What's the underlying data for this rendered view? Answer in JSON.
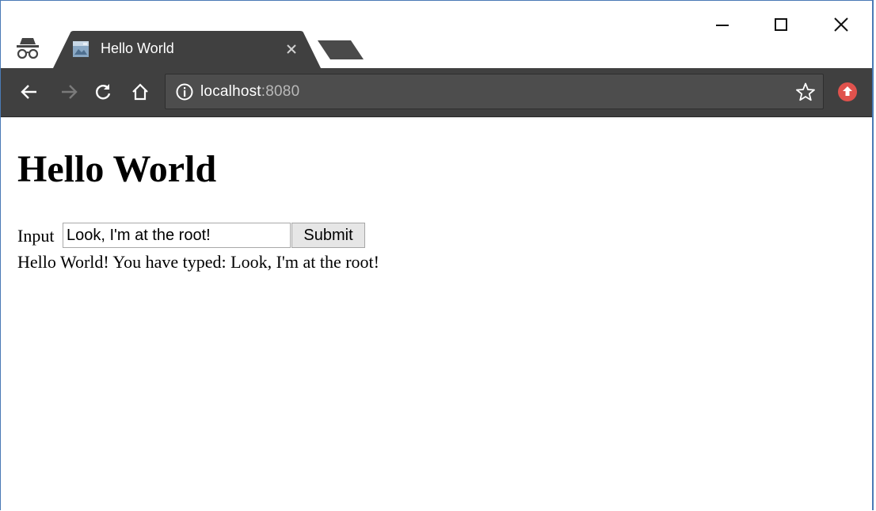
{
  "browser": {
    "mode_icon": "incognito-icon",
    "tab": {
      "title": "Hello World",
      "favicon": "page-favicon-icon",
      "close_icon": "close-icon"
    },
    "window_controls": {
      "minimize_icon": "minimize-icon",
      "maximize_icon": "maximize-icon",
      "close_icon": "close-icon"
    },
    "toolbar": {
      "back_icon": "arrow-left-icon",
      "forward_icon": "arrow-right-icon",
      "reload_icon": "reload-icon",
      "home_icon": "home-icon",
      "info_icon": "info-icon",
      "url_host": "localhost",
      "url_port": ":8080",
      "bookmark_icon": "star-icon",
      "extension_icon": "upload-badge-icon"
    },
    "colors": {
      "tab_active": "#404040",
      "toolbar": "#404040",
      "omnibox": "#4d4d4d",
      "extension_badge": "#e0524d"
    }
  },
  "page": {
    "heading": "Hello World",
    "form": {
      "label": "Input",
      "input_value": "Look, I'm at the root!",
      "submit_label": "Submit"
    },
    "result": "Hello World! You have typed: Look, I'm at the root!"
  }
}
